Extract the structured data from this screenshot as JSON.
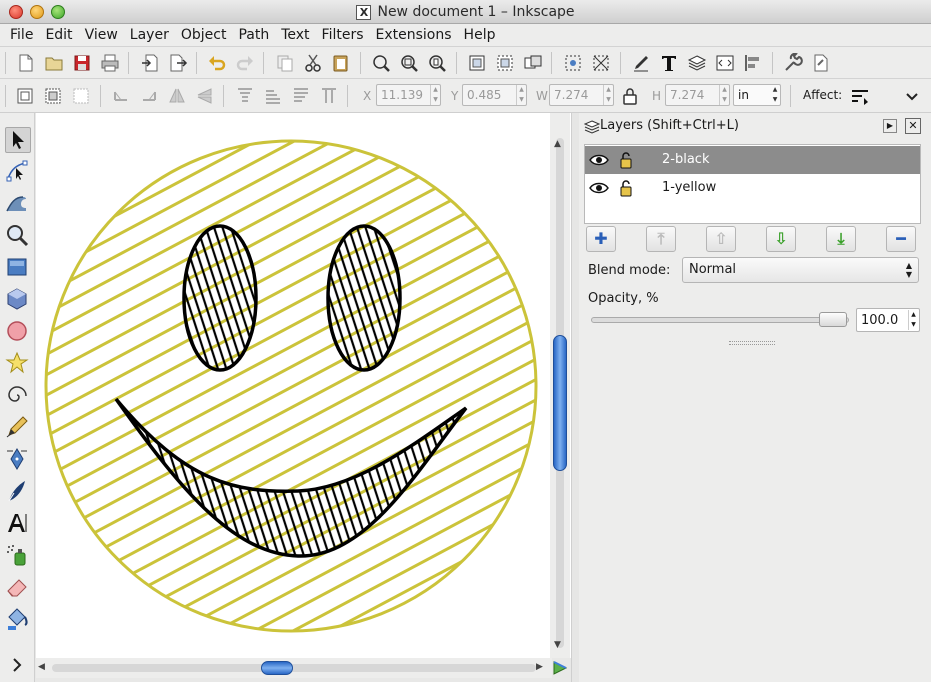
{
  "window": {
    "title": "New document 1 – Inkscape",
    "x_icon": "X"
  },
  "menu": [
    "File",
    "Edit",
    "View",
    "Layer",
    "Object",
    "Path",
    "Text",
    "Filters",
    "Extensions",
    "Help"
  ],
  "toolbar2": {
    "x_label": "X",
    "x_value": "11.139",
    "y_label": "Y",
    "y_value": "0.485",
    "w_label": "W",
    "w_value": "7.274",
    "h_label": "H",
    "h_value": "7.274",
    "unit": "in",
    "affect_label": "Affect:"
  },
  "layers_panel": {
    "title": "Layers (Shift+Ctrl+L)",
    "layers": [
      {
        "name": "2-black",
        "selected": true
      },
      {
        "name": "1-yellow",
        "selected": false
      }
    ],
    "blend_mode_label": "Blend mode:",
    "blend_mode_value": "Normal",
    "opacity_label": "Opacity, %",
    "opacity_value": "100.0",
    "opacity_fraction": 1.0
  },
  "drawing": {
    "yellow": "#cbc33a",
    "black": "#000000"
  },
  "colors": {
    "selected_row": "#8c8c8c",
    "scroll_blue": "#3d7ed8"
  }
}
